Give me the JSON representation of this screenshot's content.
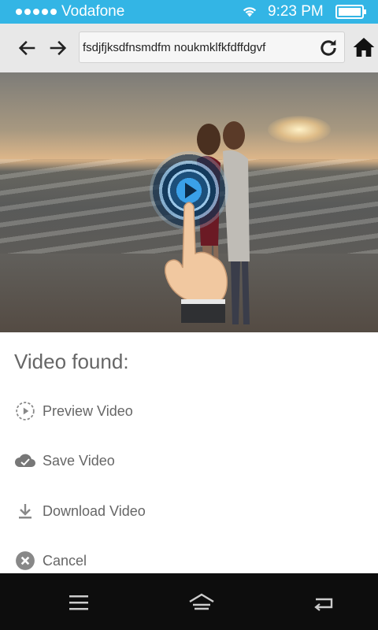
{
  "status_bar": {
    "carrier": "Vodafone",
    "time": "9:23 PM",
    "signal_dots": 5,
    "battery_level": 1.0
  },
  "toolbar": {
    "url": "fsdjfjksdfnsmdfm noukmklfkfdffdgvf",
    "back_icon": "arrow-left-icon",
    "forward_icon": "arrow-right-icon",
    "reload_icon": "reload-icon",
    "home_icon": "home-icon"
  },
  "sheet": {
    "title": "Video found:",
    "options": [
      {
        "label": "Preview Video",
        "icon": "preview-icon"
      },
      {
        "label": "Save Video",
        "icon": "cloud-check-icon"
      },
      {
        "label": "Download Video",
        "icon": "download-icon"
      },
      {
        "label": "Cancel",
        "icon": "cancel-icon"
      }
    ]
  },
  "navbar": {
    "menu_icon": "menu-icon",
    "home_icon": "home-outline-icon",
    "back_icon": "back-icon"
  },
  "colors": {
    "status_bar": "#33b5e5",
    "toolbar": "#e8e8e8",
    "sheet_text": "#666666",
    "navbar": "#0d0d0d",
    "play_button": "#3aa0e8"
  }
}
